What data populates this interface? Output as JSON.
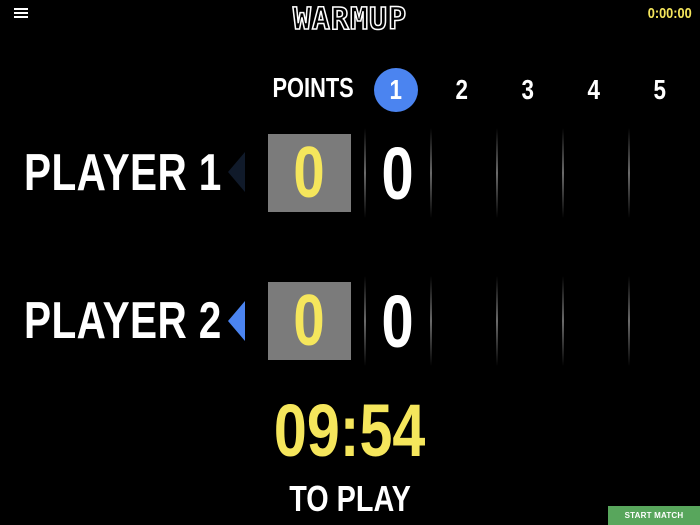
{
  "header": {
    "title": "WARMUP",
    "clock": "0:00:00"
  },
  "points_label": "POINTS",
  "games": [
    {
      "label": "1",
      "active": true
    },
    {
      "label": "2"
    },
    {
      "label": "3"
    },
    {
      "label": "4"
    },
    {
      "label": "5"
    }
  ],
  "players": [
    {
      "name": "PLAYER 1",
      "points": "0",
      "game1_score": "0",
      "serving": false
    },
    {
      "name": "PLAYER 2",
      "points": "0",
      "game1_score": "0",
      "serving": true
    }
  ],
  "timer": {
    "value": "09:54",
    "label": "TO PLAY"
  },
  "start_button": {
    "label": "START MATCH"
  },
  "colors": {
    "accent_blue": "#4b84f0",
    "score_yellow": "#f5e65c",
    "start_green": "#58a65c",
    "box_gray": "#7b7b7b"
  }
}
